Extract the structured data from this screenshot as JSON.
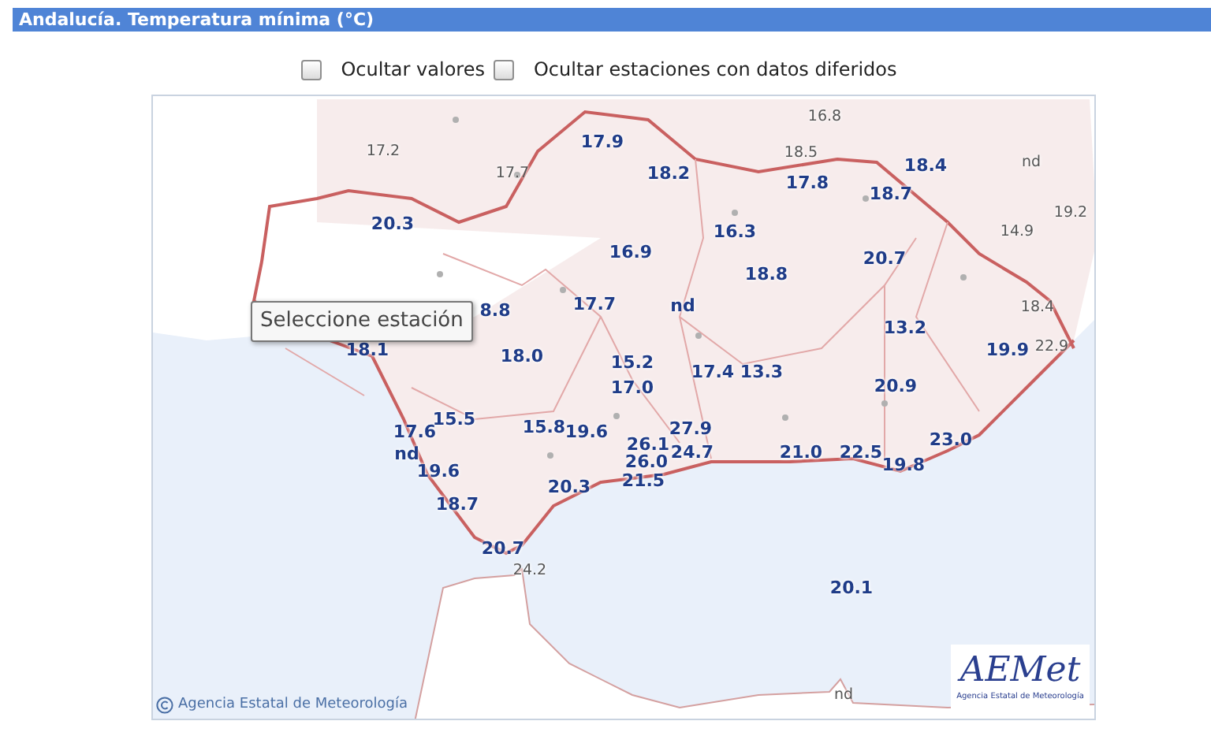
{
  "header": {
    "title": "Andalucía. Temperatura mínima (°C)"
  },
  "options": [
    {
      "label": "Ocultar valores",
      "checked": false
    },
    {
      "label": "Ocultar estaciones con datos diferidos",
      "checked": false
    }
  ],
  "map": {
    "labels": [
      {
        "text": "16.8",
        "kind": "other"
      },
      {
        "text": "17.2",
        "kind": "other"
      },
      {
        "text": "17.9",
        "kind": "region"
      },
      {
        "text": "18.5",
        "kind": "other"
      },
      {
        "text": "nd",
        "kind": "other"
      },
      {
        "text": "17.7",
        "kind": "other"
      },
      {
        "text": "18.2",
        "kind": "region"
      },
      {
        "text": "17.8",
        "kind": "region"
      },
      {
        "text": "18.4",
        "kind": "region"
      },
      {
        "text": "18.7",
        "kind": "region"
      },
      {
        "text": "19.2",
        "kind": "other"
      },
      {
        "text": "20.3",
        "kind": "region"
      },
      {
        "text": "16.3",
        "kind": "region"
      },
      {
        "text": "14.9",
        "kind": "other"
      },
      {
        "text": "16.9",
        "kind": "region"
      },
      {
        "text": "20.7",
        "kind": "region"
      },
      {
        "text": "18.8",
        "kind": "region"
      },
      {
        "text": "8.8",
        "kind": "region"
      },
      {
        "text": "17.7",
        "kind": "region"
      },
      {
        "text": "nd",
        "kind": "region"
      },
      {
        "text": "18.4",
        "kind": "other"
      },
      {
        "text": "13.2",
        "kind": "region"
      },
      {
        "text": "18.1",
        "kind": "region"
      },
      {
        "text": "18.0",
        "kind": "region"
      },
      {
        "text": "15.2",
        "kind": "region"
      },
      {
        "text": "19.9",
        "kind": "region"
      },
      {
        "text": "22.9",
        "kind": "other"
      },
      {
        "text": "17.4",
        "kind": "region"
      },
      {
        "text": "13.3",
        "kind": "region"
      },
      {
        "text": "17.0",
        "kind": "region"
      },
      {
        "text": "20.9",
        "kind": "region"
      },
      {
        "text": "17.6",
        "kind": "region"
      },
      {
        "text": "15.5",
        "kind": "region"
      },
      {
        "text": "15.8",
        "kind": "region"
      },
      {
        "text": "19.6",
        "kind": "region"
      },
      {
        "text": "27.9",
        "kind": "region"
      },
      {
        "text": "26.1",
        "kind": "region"
      },
      {
        "text": "23.0",
        "kind": "region"
      },
      {
        "text": "nd",
        "kind": "region"
      },
      {
        "text": "19.6",
        "kind": "region"
      },
      {
        "text": "26.0",
        "kind": "region"
      },
      {
        "text": "24.7",
        "kind": "region"
      },
      {
        "text": "21.0",
        "kind": "region"
      },
      {
        "text": "22.5",
        "kind": "region"
      },
      {
        "text": "19.8",
        "kind": "region"
      },
      {
        "text": "20.3",
        "kind": "region"
      },
      {
        "text": "21.5",
        "kind": "region"
      },
      {
        "text": "18.7",
        "kind": "region"
      },
      {
        "text": "20.7",
        "kind": "region"
      },
      {
        "text": "24.2",
        "kind": "other"
      },
      {
        "text": "20.1",
        "kind": "region"
      },
      {
        "text": "nd",
        "kind": "other"
      }
    ],
    "tooltip": "Seleccione estación",
    "copyright": "Agencia Estatal de Meteorología",
    "logo": {
      "name": "AEMet",
      "subtitle": "Agencia Estatal de Meteorología"
    }
  }
}
